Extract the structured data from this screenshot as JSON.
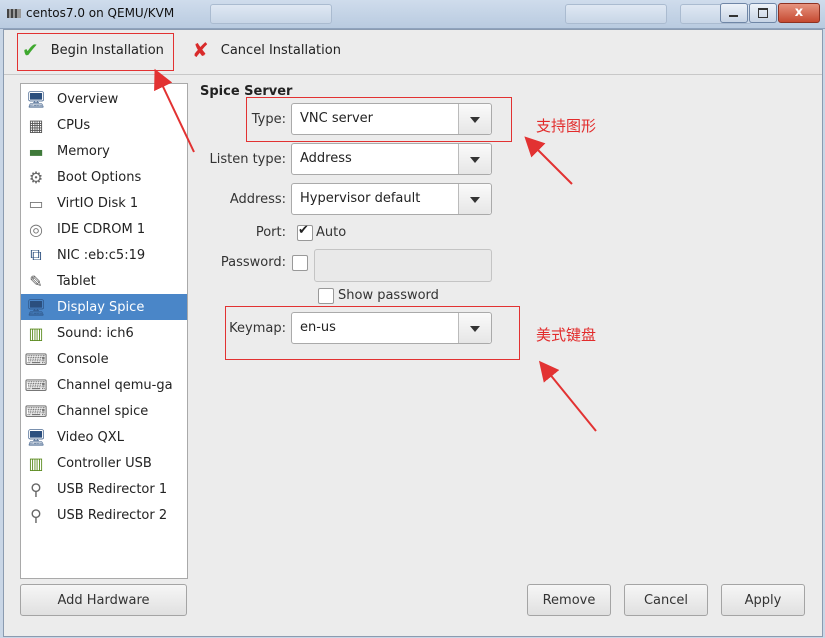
{
  "window": {
    "title": "centos7.0 on QEMU/KVM",
    "close_glyph": "x"
  },
  "toolbar": {
    "begin_label": "Begin Installation",
    "cancel_label": "Cancel Installation"
  },
  "hardware": {
    "items": [
      {
        "label": "Overview",
        "icon": "monitor-icon"
      },
      {
        "label": "CPUs",
        "icon": "cpu-icon"
      },
      {
        "label": "Memory",
        "icon": "memory-icon"
      },
      {
        "label": "Boot Options",
        "icon": "gears-icon"
      },
      {
        "label": "VirtIO Disk 1",
        "icon": "disk-icon"
      },
      {
        "label": "IDE CDROM 1",
        "icon": "cdrom-icon"
      },
      {
        "label": "NIC :eb:c5:19",
        "icon": "network-icon"
      },
      {
        "label": "Tablet",
        "icon": "tablet-icon"
      },
      {
        "label": "Display Spice",
        "icon": "display-icon",
        "selected": true
      },
      {
        "label": "Sound: ich6",
        "icon": "sound-card-icon"
      },
      {
        "label": "Console",
        "icon": "console-icon"
      },
      {
        "label": "Channel qemu-ga",
        "icon": "channel-icon"
      },
      {
        "label": "Channel spice",
        "icon": "channel-icon"
      },
      {
        "label": "Video QXL",
        "icon": "monitor-icon"
      },
      {
        "label": "Controller USB",
        "icon": "controller-icon"
      },
      {
        "label": "USB Redirector 1",
        "icon": "usb-icon"
      },
      {
        "label": "USB Redirector 2",
        "icon": "usb-icon"
      }
    ],
    "add_label": "Add Hardware"
  },
  "details": {
    "section_title": "Spice Server",
    "type_label": "Type:",
    "type_value": "VNC server",
    "listen_label": "Listen type:",
    "listen_value": "Address",
    "address_label": "Address:",
    "address_value": "Hypervisor default",
    "port_label": "Port:",
    "port_auto_label": "Auto",
    "port_auto_checked": true,
    "password_label": "Password:",
    "password_value": "",
    "show_password_label": "Show password",
    "keymap_label": "Keymap:",
    "keymap_value": "en-us"
  },
  "annotations": {
    "type_note": "支持图形",
    "keymap_note": "美式键盘",
    "color": "#e23232"
  },
  "buttons": {
    "remove": "Remove",
    "cancel": "Cancel",
    "apply": "Apply"
  }
}
